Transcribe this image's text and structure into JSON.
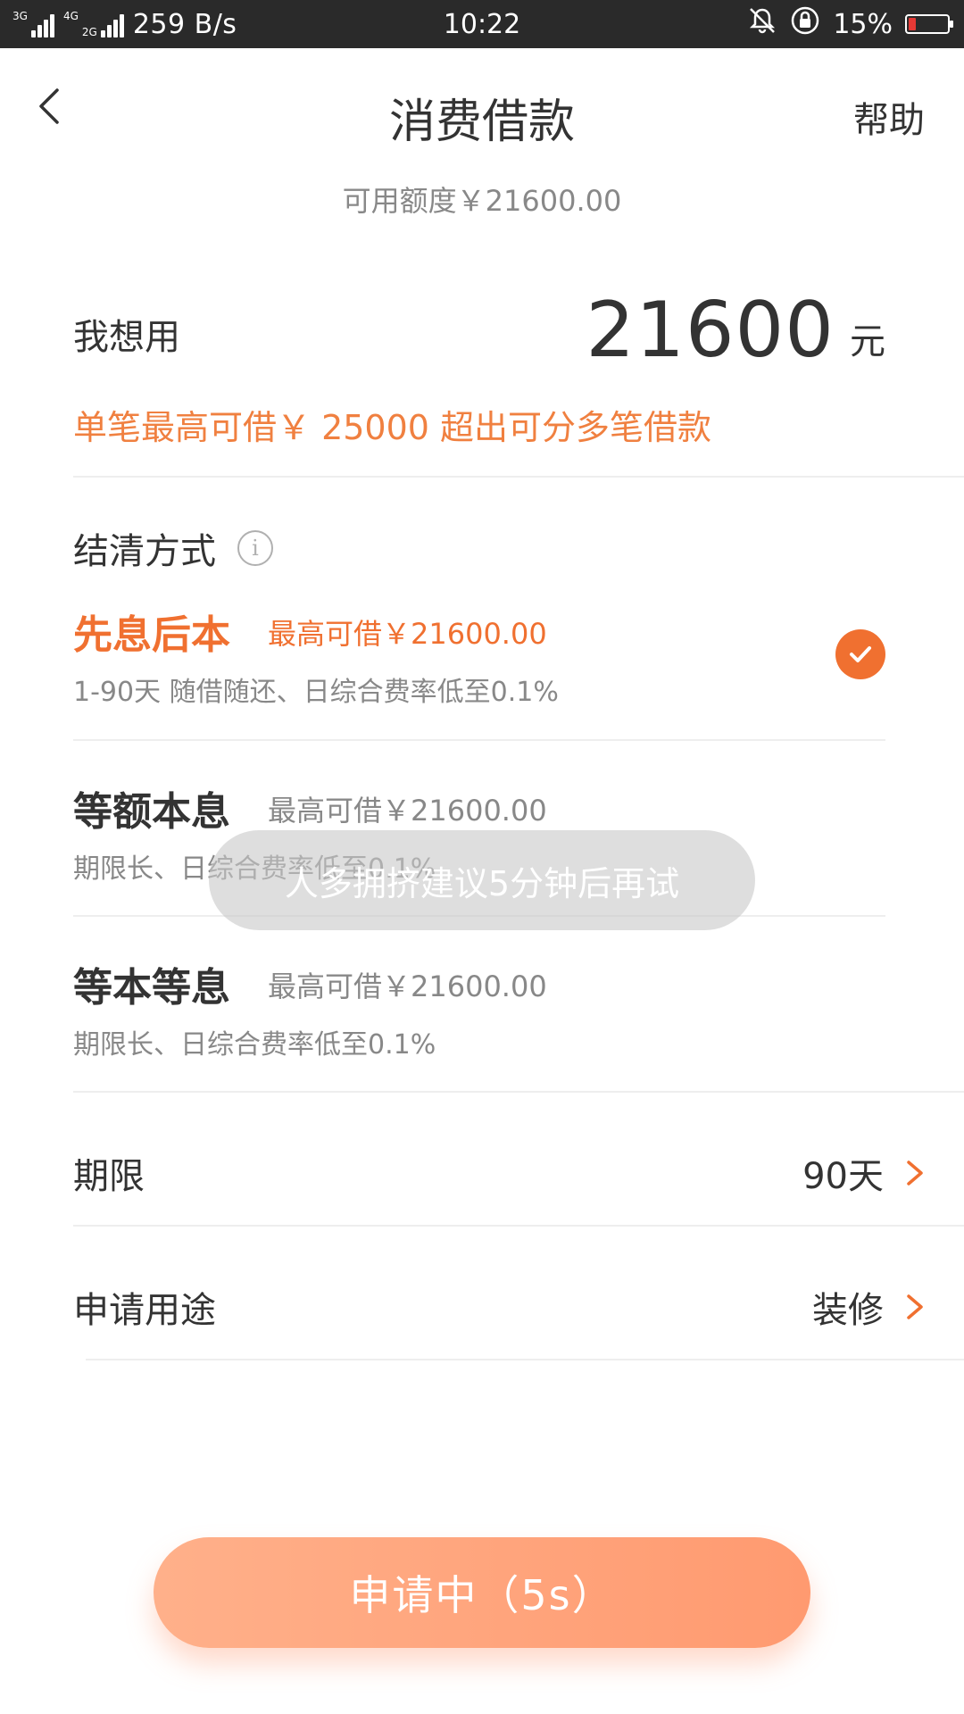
{
  "status_bar": {
    "net1": "3G",
    "net2": "4G",
    "net3": "2G",
    "speed": "259 B/s",
    "time": "10:22",
    "battery": "15%"
  },
  "header": {
    "title": "消费借款",
    "help": "帮助"
  },
  "credit": {
    "available": "可用额度￥21600.00"
  },
  "amount": {
    "label": "我想用",
    "value": "21600",
    "unit": "元",
    "note": "单笔最高可借￥ 25000  超出可分多笔借款"
  },
  "repayment": {
    "title": "结清方式",
    "options": [
      {
        "name": "先息后本",
        "max": "最高可借￥21600.00",
        "desc": "1-90天 随借随还、日综合费率低至0.1%"
      },
      {
        "name": "等额本息",
        "max": "最高可借￥21600.00",
        "desc": "期限长、日综合费率低至0.1%"
      },
      {
        "name": "等本等息",
        "max": "最高可借￥21600.00",
        "desc": "期限长、日综合费率低至0.1%"
      }
    ]
  },
  "term": {
    "label": "期限",
    "value": "90天"
  },
  "purpose": {
    "label": "申请用途",
    "value": "装修"
  },
  "toast": "人多拥挤建议5分钟后再试",
  "apply_button": "申请中（5s）",
  "colors": {
    "accent": "#f07030",
    "note": "#f08040",
    "button": "#ff9a70"
  }
}
